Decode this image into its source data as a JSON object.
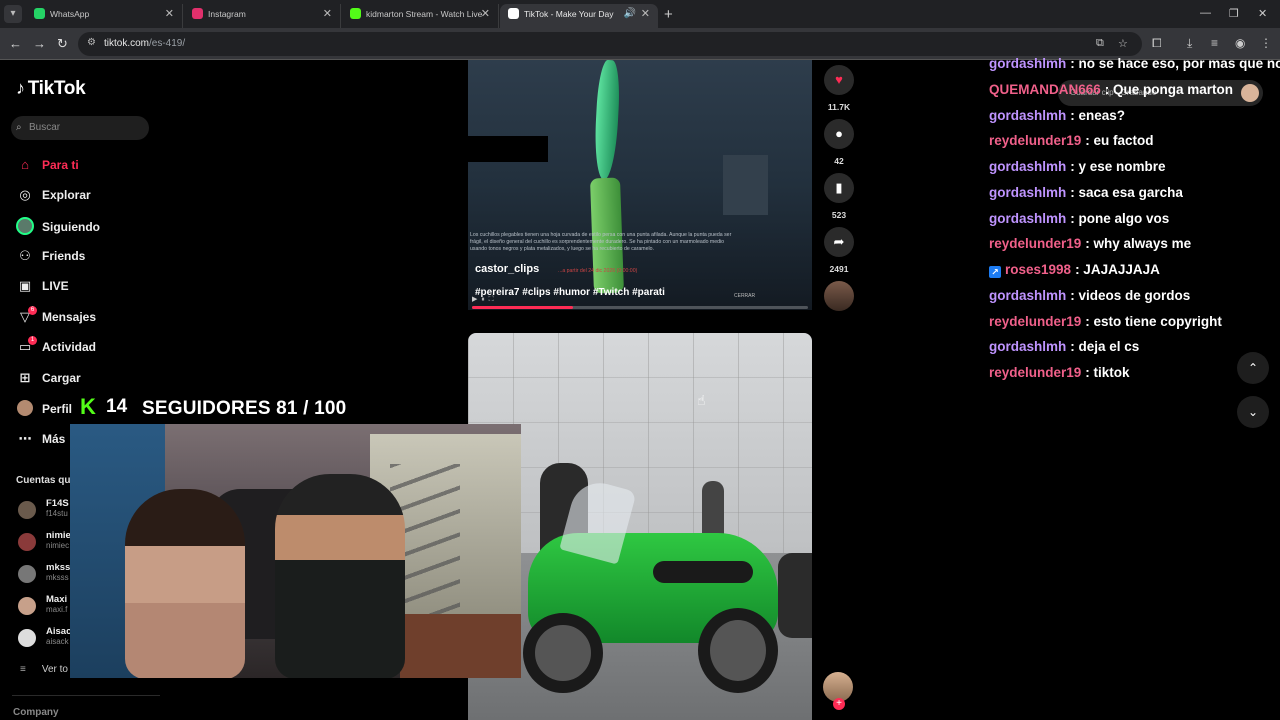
{
  "browser": {
    "tabs": [
      {
        "label": "WhatsApp",
        "fav_color": "#25d366"
      },
      {
        "label": "Instagram",
        "fav_color": "#e1306c"
      },
      {
        "label": "kidmarton Stream - Watch Live",
        "fav_color": "#53fc18"
      },
      {
        "label": "TikTok - Make Your Day",
        "fav_color": "#ffffff"
      }
    ],
    "url_host": "tiktok.com",
    "url_path": "/es-419/"
  },
  "tiktok": {
    "logo": "TikTok",
    "search_placeholder": "Buscar",
    "nav": [
      {
        "label": "Para ti",
        "icon": "home-icon"
      },
      {
        "label": "Explorar",
        "icon": "compass-icon"
      },
      {
        "label": "Siguiendo",
        "icon": "avatar-icon"
      },
      {
        "label": "Friends",
        "icon": "friends-icon"
      },
      {
        "label": "LIVE",
        "icon": "live-icon"
      },
      {
        "label": "Mensajes",
        "icon": "messages-icon",
        "badge": "6"
      },
      {
        "label": "Actividad",
        "icon": "activity-icon",
        "badge": "1"
      },
      {
        "label": "Cargar",
        "icon": "upload-icon"
      },
      {
        "label": "Perfil",
        "icon": "profile-icon"
      },
      {
        "label": "Más",
        "icon": "more-icon"
      }
    ],
    "following_title": "Cuentas que",
    "accounts": [
      {
        "name": "F14S",
        "handle": "f14stu"
      },
      {
        "name": "nimie",
        "handle": "nimiec"
      },
      {
        "name": "mkss",
        "handle": "mksss"
      },
      {
        "name": "Maxi",
        "handle": "maxi.f"
      },
      {
        "name": "Aisac",
        "handle": "aisack"
      }
    ],
    "see_all": "Ver to",
    "company": "Company"
  },
  "stream_overlay": {
    "viewers": "14",
    "followers_goal": "SEGUIDORES 81 / 100"
  },
  "video1": {
    "username": "castor_clips",
    "hashtags": "#pereira7 #clips #humor #Twitch #parati",
    "description": "Los cuchillos plegables tienen una hoja curvada de estilo persa con una punta afilada. Aunque la punta pueda ser frágil, el diseño general del cuchillo es sorprendentemente duradero. Se ha pintado con un marmoleado medio usando tonos negros y plata metalizados, y luego se ha recubierto de caramelo.",
    "date_line": "...a partir del 24 dic 2026 (0:00:00)",
    "close_label": "CERRAR",
    "progress": 0.3,
    "likes": "11.7K",
    "comments": "42",
    "saves": "523",
    "shares": "2491"
  },
  "chat": {
    "recording_text": "Guardar clip · Grabando",
    "messages": [
      {
        "user": "gordashlmh",
        "text": ": no se hace eso, por mas que no s",
        "color": "#bf94ff"
      },
      {
        "user": "QUEMANDAN666",
        "text": ": Que ponga marton",
        "color": "#f0608a"
      },
      {
        "user": "gordashlmh",
        "text": ": eneas?",
        "color": "#bf94ff"
      },
      {
        "user": "reydelunder19",
        "text": ": eu factod",
        "color": "#f0608a"
      },
      {
        "user": "gordashlmh",
        "text": ": y ese nombre",
        "color": "#bf94ff"
      },
      {
        "user": "gordashlmh",
        "text": ": saca esa garcha",
        "color": "#bf94ff"
      },
      {
        "user": "gordashlmh",
        "text": ": pone algo vos",
        "color": "#bf94ff"
      },
      {
        "user": "reydelunder19",
        "text": ": why always me",
        "color": "#f0608a"
      },
      {
        "user": "roses1998",
        "text": ": JAJAJJAJA",
        "color": "#f0608a"
      },
      {
        "user": "gordashlmh",
        "text": ": videos de gordos",
        "color": "#bf94ff"
      },
      {
        "user": "reydelunder19",
        "text": ": esto tiene copyright",
        "color": "#f0608a"
      },
      {
        "user": "gordashlmh",
        "text": ": deja el cs",
        "color": "#bf94ff"
      },
      {
        "user": "reydelunder19",
        "text": ": tiktok",
        "color": "#f0608a"
      }
    ]
  }
}
